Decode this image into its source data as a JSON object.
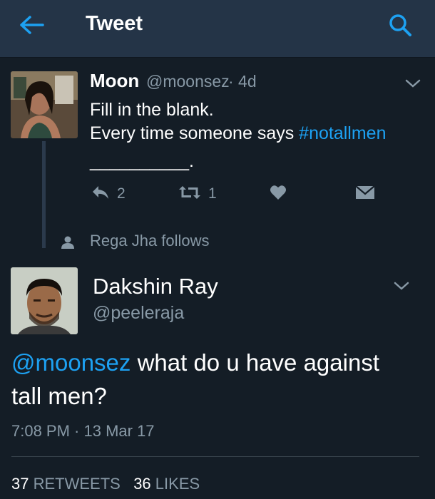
{
  "header": {
    "title": "Tweet"
  },
  "colors": {
    "background": "#141d26",
    "header": "#243447",
    "accent": "#1da1f2",
    "muted": "#8899a6"
  },
  "parent_tweet": {
    "name": "Moon",
    "handle": "@moonsez",
    "age": "· 4d",
    "line1": "Fill in the blank.",
    "line2_prefix": "Every time someone says ",
    "hashtag": "#notallmen",
    "line3": "__________.",
    "reply_count": "2",
    "retweet_count": "1"
  },
  "follow_context": {
    "text": "Rega Jha follows"
  },
  "main_tweet": {
    "name": "Dakshin Ray",
    "handle": "@peeleraja",
    "mention": "@moonsez",
    "text_line1_rest": " what do u have against",
    "text_line2": "tall men?",
    "timestamp": "7:08 PM · 13 Mar 17",
    "retweets_count": "37",
    "retweets_label": "RETWEETS",
    "likes_count": "36",
    "likes_label": "LIKES"
  }
}
